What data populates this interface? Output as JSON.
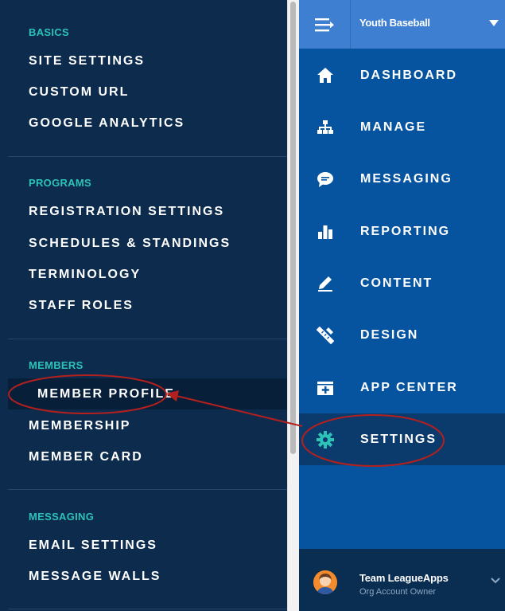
{
  "settings_menu": {
    "sections": [
      {
        "header": "BASICS",
        "items": [
          "SITE SETTINGS",
          "CUSTOM URL",
          "GOOGLE ANALYTICS"
        ]
      },
      {
        "header": "PROGRAMS",
        "items": [
          "REGISTRATION SETTINGS",
          "SCHEDULES & STANDINGS",
          "TERMINOLOGY",
          "STAFF ROLES"
        ]
      },
      {
        "header": "MEMBERS",
        "items": [
          "MEMBER PROFILE",
          "MEMBERSHIP",
          "MEMBER CARD"
        ]
      },
      {
        "header": "MESSAGING",
        "items": [
          "EMAIL SETTINGS",
          "MESSAGE WALLS"
        ]
      }
    ]
  },
  "main_nav": {
    "org_name": "Youth Baseball",
    "items": [
      {
        "label": "DASHBOARD",
        "icon": "home-icon"
      },
      {
        "label": "MANAGE",
        "icon": "org-chart-icon"
      },
      {
        "label": "MESSAGING",
        "icon": "chat-bubble-icon"
      },
      {
        "label": "REPORTING",
        "icon": "bar-chart-icon"
      },
      {
        "label": "CONTENT",
        "icon": "pencil-icon"
      },
      {
        "label": "DESIGN",
        "icon": "design-tools-icon"
      },
      {
        "label": "APP CENTER",
        "icon": "app-add-icon"
      },
      {
        "label": "SETTINGS",
        "icon": "gear-icon"
      }
    ],
    "active_item": "SETTINGS"
  },
  "user": {
    "name": "Team LeagueApps",
    "role": "Org Account Owner"
  },
  "colors": {
    "left_bg": "#0c2b4d",
    "right_bg": "#06549f",
    "nav_top_bg": "#3e7fd1",
    "section_header": "#2dc2b8",
    "settings_icon": "#2dc2b8",
    "annotation_red": "#b3201e"
  }
}
